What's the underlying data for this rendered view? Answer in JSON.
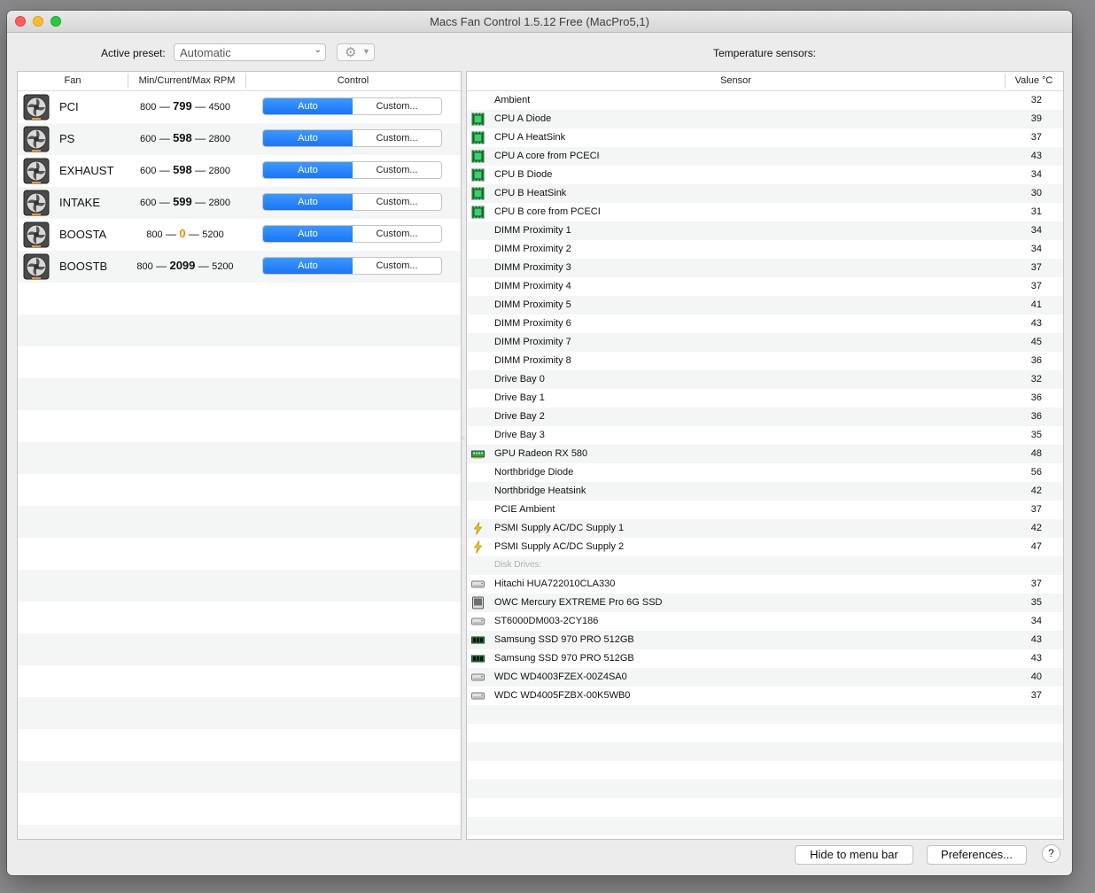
{
  "window": {
    "title": "Macs Fan Control 1.5.12 Free (MacPro5,1)"
  },
  "toolbar": {
    "active_preset_label": "Active preset:",
    "preset_value": "Automatic",
    "temperature_label": "Temperature sensors:"
  },
  "fans_table": {
    "headers": {
      "fan": "Fan",
      "rpm": "Min/Current/Max RPM",
      "control": "Control"
    },
    "rows": [
      {
        "name": "PCI",
        "min": "800",
        "current": "799",
        "max": "4500",
        "auto": "Auto",
        "custom": "Custom..."
      },
      {
        "name": "PS",
        "min": "600",
        "current": "598",
        "max": "2800",
        "auto": "Auto",
        "custom": "Custom..."
      },
      {
        "name": "EXHAUST",
        "min": "600",
        "current": "598",
        "max": "2800",
        "auto": "Auto",
        "custom": "Custom..."
      },
      {
        "name": "INTAKE",
        "min": "600",
        "current": "599",
        "max": "2800",
        "auto": "Auto",
        "custom": "Custom..."
      },
      {
        "name": "BOOSTA",
        "min": "800",
        "current": "0",
        "max": "5200",
        "auto": "Auto",
        "custom": "Custom..."
      },
      {
        "name": "BOOSTB",
        "min": "800",
        "current": "2099",
        "max": "5200",
        "auto": "Auto",
        "custom": "Custom..."
      }
    ],
    "dash": "—"
  },
  "sensors_table": {
    "headers": {
      "sensor": "Sensor",
      "value": "Value °C"
    },
    "rows": [
      {
        "name": "Ambient",
        "value": "32",
        "icon": "none"
      },
      {
        "name": "CPU A Diode",
        "value": "39",
        "icon": "cpu-chip-icon"
      },
      {
        "name": "CPU A HeatSink",
        "value": "37",
        "icon": "cpu-chip-icon"
      },
      {
        "name": "CPU A core from PCECI",
        "value": "43",
        "icon": "cpu-chip-icon"
      },
      {
        "name": "CPU B Diode",
        "value": "34",
        "icon": "cpu-chip-icon"
      },
      {
        "name": "CPU B HeatSink",
        "value": "30",
        "icon": "cpu-chip-icon"
      },
      {
        "name": "CPU B core from PCECI",
        "value": "31",
        "icon": "cpu-chip-icon"
      },
      {
        "name": "DIMM Proximity 1",
        "value": "34",
        "icon": "none"
      },
      {
        "name": "DIMM Proximity 2",
        "value": "34",
        "icon": "none"
      },
      {
        "name": "DIMM Proximity 3",
        "value": "37",
        "icon": "none"
      },
      {
        "name": "DIMM Proximity 4",
        "value": "37",
        "icon": "none"
      },
      {
        "name": "DIMM Proximity 5",
        "value": "41",
        "icon": "none"
      },
      {
        "name": "DIMM Proximity 6",
        "value": "43",
        "icon": "none"
      },
      {
        "name": "DIMM Proximity 7",
        "value": "45",
        "icon": "none"
      },
      {
        "name": "DIMM Proximity 8",
        "value": "36",
        "icon": "none"
      },
      {
        "name": "Drive Bay 0",
        "value": "32",
        "icon": "none"
      },
      {
        "name": "Drive Bay 1",
        "value": "36",
        "icon": "none"
      },
      {
        "name": "Drive Bay 2",
        "value": "36",
        "icon": "none"
      },
      {
        "name": "Drive Bay 3",
        "value": "35",
        "icon": "none"
      },
      {
        "name": "GPU Radeon RX 580",
        "value": "48",
        "icon": "gpu-card-icon"
      },
      {
        "name": "Northbridge Diode",
        "value": "56",
        "icon": "none"
      },
      {
        "name": "Northbridge Heatsink",
        "value": "42",
        "icon": "none"
      },
      {
        "name": "PCIE Ambient",
        "value": "37",
        "icon": "none"
      },
      {
        "name": "PSMI Supply AC/DC Supply 1",
        "value": "42",
        "icon": "lightning-icon"
      },
      {
        "name": "PSMI Supply AC/DC Supply 2",
        "value": "47",
        "icon": "lightning-icon"
      },
      {
        "section": "Disk Drives:"
      },
      {
        "name": "Hitachi HUA722010CLA330",
        "value": "37",
        "icon": "hard-drive-icon"
      },
      {
        "name": "OWC Mercury EXTREME Pro 6G SSD",
        "value": "35",
        "icon": "ssd-drive-icon"
      },
      {
        "name": "ST6000DM003-2CY186",
        "value": "34",
        "icon": "hard-drive-icon"
      },
      {
        "name": "Samsung SSD 970 PRO 512GB",
        "value": "43",
        "icon": "nvme-ssd-icon"
      },
      {
        "name": "Samsung SSD 970 PRO 512GB",
        "value": "43",
        "icon": "nvme-ssd-icon"
      },
      {
        "name": "WDC WD4003FZEX-00Z4SA0",
        "value": "40",
        "icon": "hard-drive-icon"
      },
      {
        "name": "WDC WD4005FZBX-00K5WB0",
        "value": "37",
        "icon": "hard-drive-icon"
      }
    ]
  },
  "footer": {
    "hide_button": "Hide to menu bar",
    "preferences_button": "Preferences...",
    "help_button": "?"
  },
  "colors": {
    "accent": "#1a75f5",
    "zero_rpm": "#f08a00",
    "chip_green": "#2fa84f"
  }
}
